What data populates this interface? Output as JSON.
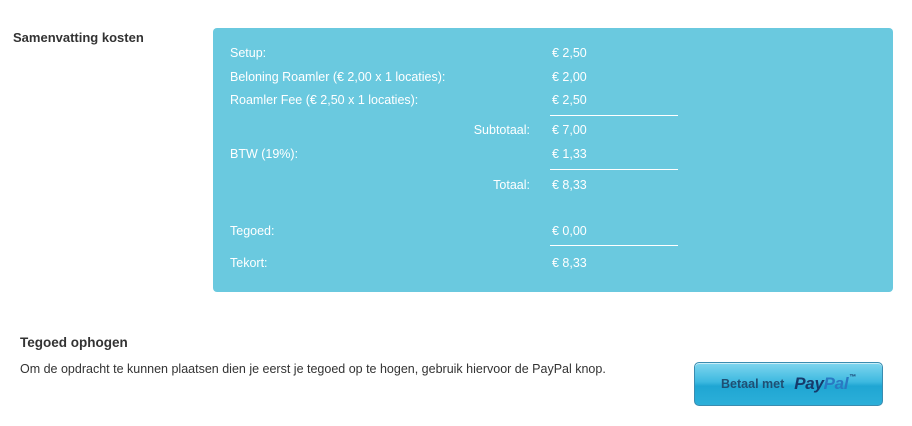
{
  "summary": {
    "title": "Samenvatting kosten",
    "rows": [
      {
        "label": "Setup:",
        "value": "€ 2,50"
      },
      {
        "label": "Beloning Roamler (€ 2,00 x 1 locaties):",
        "value": "€ 2,00"
      },
      {
        "label": "Roamler Fee (€ 2,50 x 1 locaties):",
        "value": "€ 2,50"
      },
      {
        "label": "Subtotaal:",
        "value": "€ 7,00"
      },
      {
        "label": "BTW (19%):",
        "value": "€ 1,33"
      },
      {
        "label": "Totaal:",
        "value": "€ 8,33"
      },
      {
        "label": "Tegoed:",
        "value": "€ 0,00"
      },
      {
        "label": "Tekort:",
        "value": "€ 8,33"
      }
    ]
  },
  "topup": {
    "title": "Tegoed ophogen",
    "description": "Om de opdracht te kunnen plaatsen dien je eerst je tegoed op te hogen, gebruik hiervoor de PayPal knop.",
    "button": {
      "prefix": "Betaal met",
      "logo_pay": "Pay",
      "logo_pal": "Pal",
      "logo_tm": "™"
    }
  },
  "colors": {
    "summary_background": "#6ac9df",
    "text": "#333333",
    "paypal_button": "#2cafd9"
  }
}
